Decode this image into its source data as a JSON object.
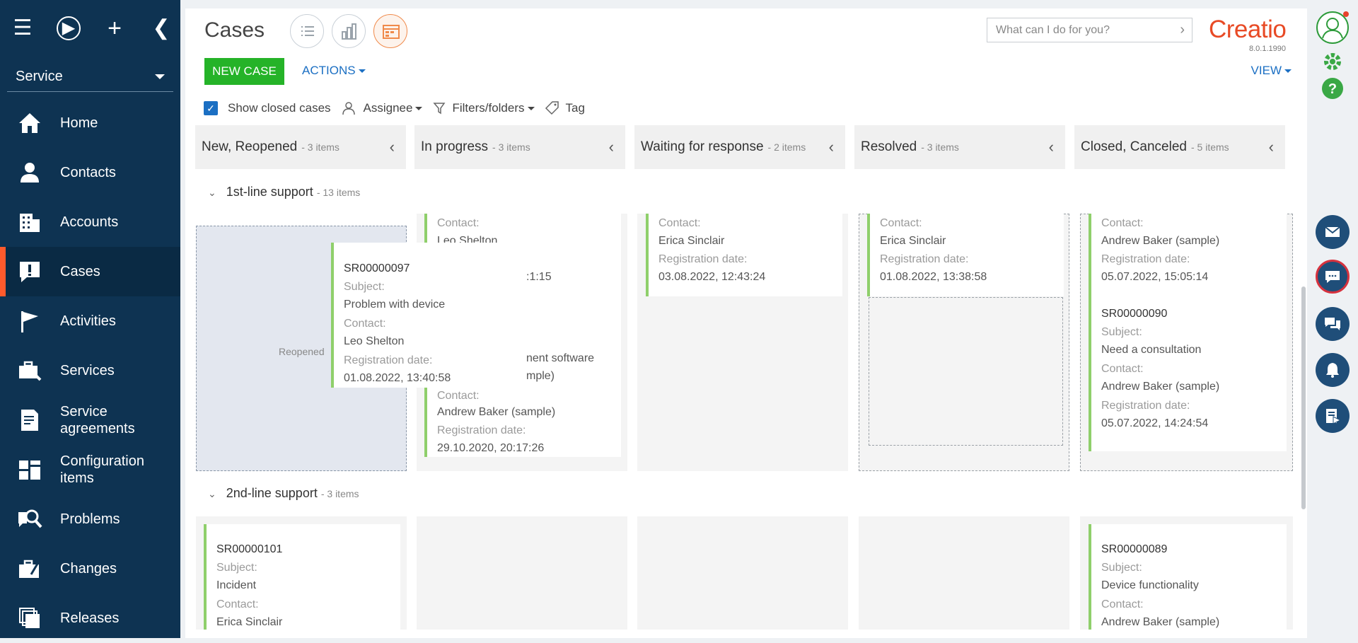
{
  "workspace": "Service",
  "nav": [
    {
      "label": "Home",
      "icon": "home-icon"
    },
    {
      "label": "Contacts",
      "icon": "person-icon"
    },
    {
      "label": "Accounts",
      "icon": "building-icon"
    },
    {
      "label": "Cases",
      "icon": "exclamation-icon"
    },
    {
      "label": "Activities",
      "icon": "flag-icon"
    },
    {
      "label": "Services",
      "icon": "briefcase-icon"
    },
    {
      "label": "Service agreements",
      "icon": "document-icon"
    },
    {
      "label": "Configuration items",
      "icon": "blocks-icon"
    },
    {
      "label": "Problems",
      "icon": "magnifier-icon"
    },
    {
      "label": "Changes",
      "icon": "briefcase-edit-icon"
    },
    {
      "label": "Releases",
      "icon": "stack-icon"
    }
  ],
  "page": {
    "title": "Cases"
  },
  "toolbar": {
    "new_case": "NEW CASE",
    "actions": "ACTIONS",
    "view": "VIEW"
  },
  "search": {
    "placeholder": "What can I do for you?"
  },
  "brand": {
    "logo": "Creatio",
    "version": "8.0.1.1990",
    "accent": "#e84a25"
  },
  "filters": {
    "show_closed": "Show closed cases",
    "assignee": "Assignee",
    "filters_folders": "Filters/folders",
    "tag": "Tag"
  },
  "columns": [
    {
      "title": "New, Reopened",
      "count": "- 3 items"
    },
    {
      "title": "In progress",
      "count": "- 3 items"
    },
    {
      "title": "Waiting for response",
      "count": "- 2 items"
    },
    {
      "title": "Resolved",
      "count": "- 3 items"
    },
    {
      "title": "Closed, Canceled",
      "count": "- 5 items"
    }
  ],
  "groups": [
    {
      "title": "1st-line support",
      "count": "- 13 items"
    },
    {
      "title": "2nd-line support",
      "count": "- 3 items"
    }
  ],
  "labels": {
    "subject": "Subject:",
    "contact": "Contact:",
    "registration_date": "Registration date:",
    "reopened": "Reopened"
  },
  "cards": {
    "c1": {
      "contact": "Leo Shelton",
      "date_fragment": ":1:15"
    },
    "c2": {
      "subject_fragment": "nent software",
      "subject_fragment2": "mple)",
      "contact": "Andrew Baker (sample)",
      "date": "29.10.2020, 20:17:26"
    },
    "c3": {
      "contact": "Erica Sinclair",
      "date": "03.08.2022, 12:43:24"
    },
    "c4": {
      "contact": "Erica Sinclair",
      "date": "01.08.2022, 13:38:58"
    },
    "c5": {
      "contact": "Andrew Baker (sample)",
      "date": "05.07.2022, 15:05:14"
    },
    "c6": {
      "number": "SR00000090",
      "subject": "Need a consultation",
      "contact": "Andrew Baker (sample)",
      "date": "05.07.2022, 14:24:54"
    },
    "drag": {
      "number": "SR00000097",
      "subject": "Problem with device",
      "contact": "Leo Shelton",
      "date": "01.08.2022, 13:40:58"
    },
    "g2a": {
      "number": "SR00000101",
      "subject": "Incident",
      "contact": "Erica Sinclair"
    },
    "g2b": {
      "number": "SR00000089",
      "subject": "Device functionality",
      "contact": "Andrew Baker (sample)"
    }
  }
}
